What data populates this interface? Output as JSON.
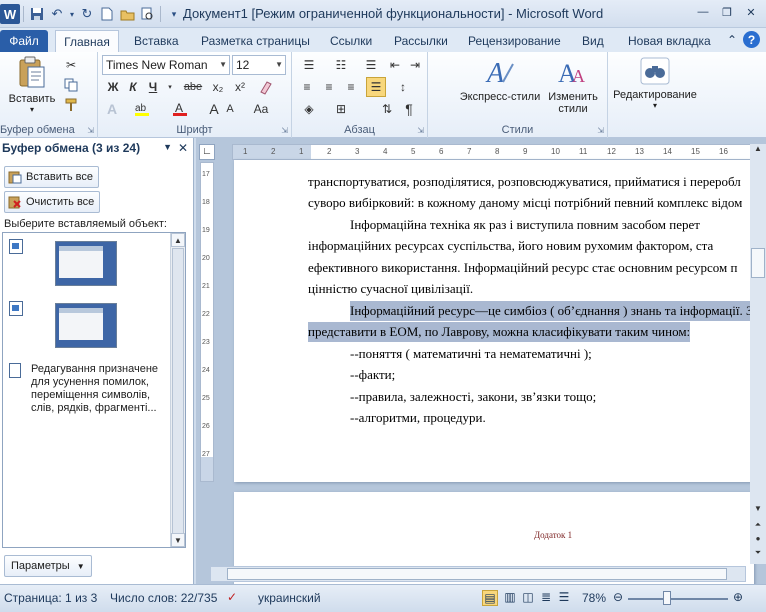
{
  "window": {
    "title": "Документ1 [Режим ограниченной функциональности] - Microsoft Word"
  },
  "tabs": [
    "Файл",
    "Главная",
    "Вставка",
    "Разметка страницы",
    "Ссылки",
    "Рассылки",
    "Рецензирование",
    "Вид",
    "Новая вкладка"
  ],
  "ribbon": {
    "paste_label": "Вставить",
    "clipboard_group": "Буфер обмена",
    "font_group": "Шрифт",
    "paragraph_group": "Абзац",
    "styles_group": "Стили",
    "font_name": "Times New Roman",
    "font_size": "12",
    "express_styles": "Экспресс-стили",
    "change_styles_l1": "Изменить",
    "change_styles_l2": "стили",
    "editing": "Редактирование",
    "bold": "Ж",
    "italic": "К",
    "underline": "Ч",
    "strike": "abe",
    "subscript": "x₂",
    "superscript": "x²",
    "grow_font": "A",
    "shrink_font": "A",
    "change_case": "Aa",
    "pilcrow": "¶"
  },
  "pane": {
    "title": "Буфер обмена (3 из 24)",
    "paste_all": "Вставить все",
    "clear_all": "Очистить все",
    "choose_label": "Выберите вставляемый объект:",
    "item_text": "Редагування призначене для усунення помилок, переміщення символів, слів, рядків, фрагменті...",
    "params": "Параметры"
  },
  "document": {
    "lines": [
      "транспортуватися, розподілятися, розповсюджуватися, прийматися і переробл",
      "суворо вибірковий: в кожному даному місці потрібний певний комплекс відом",
      "Інформаційна техніка як раз і виступила повним засобом перет",
      "інформаційних ресурсах суспільства, його новим рухомим фактором, ста",
      "ефективного використання. Інформаційний ресурс стає основним ресурсом п",
      "цінністю сучасної цивілізації.",
      "Інформаційний ресурс—це симбіоз ( об’єднання ) знань та інформації. З",
      "представити в ЕОМ, по Лаврову, можна класифікувати таким чином:",
      "--поняття ( математичні та нематематичні );",
      "--факти;",
      "--правила, залежності, закони, зв’язки тощо;",
      "--алгоритми, процедури."
    ],
    "page2_text": "Додаток 1",
    "ruler_nums_h": [
      "1",
      "2",
      "1",
      "2",
      "3",
      "4",
      "5",
      "6",
      "7",
      "8",
      "9",
      "10",
      "11",
      "12",
      "13",
      "14",
      "15",
      "16"
    ],
    "ruler_nums_v": [
      "17",
      "18",
      "19",
      "20",
      "21",
      "22",
      "23",
      "24",
      "25",
      "26",
      "27"
    ]
  },
  "status": {
    "page": "Страница: 1 из 3",
    "words": "Число слов: 22/735",
    "language": "украинский",
    "zoom": "78%"
  }
}
